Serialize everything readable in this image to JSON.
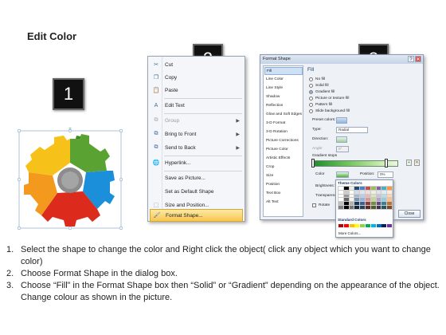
{
  "slide": {
    "title": "Edit Color"
  },
  "steps": {
    "one": "1",
    "two": "2",
    "three": "3"
  },
  "context_menu": {
    "items": [
      {
        "label": "Cut",
        "icon": "scissors-icon",
        "disabled": false,
        "submenu": false
      },
      {
        "label": "Copy",
        "icon": "copy-icon",
        "disabled": false,
        "submenu": false
      },
      {
        "label": "Paste",
        "icon": "paste-icon",
        "disabled": false,
        "submenu": false
      },
      {
        "label": "Edit Text",
        "icon": "edit-text-icon",
        "disabled": false,
        "submenu": false
      },
      {
        "label": "Group",
        "icon": "group-icon",
        "disabled": true,
        "submenu": true
      },
      {
        "label": "Bring to Front",
        "icon": "bring-front-icon",
        "disabled": false,
        "submenu": true
      },
      {
        "label": "Send to Back",
        "icon": "send-back-icon",
        "disabled": false,
        "submenu": true
      },
      {
        "label": "Hyperlink...",
        "icon": "hyperlink-icon",
        "disabled": false,
        "submenu": false
      },
      {
        "label": "Save as Picture...",
        "icon": "",
        "disabled": false,
        "submenu": false
      },
      {
        "label": "Set as Default Shape",
        "icon": "",
        "disabled": false,
        "submenu": false
      },
      {
        "label": "Size and Position...",
        "icon": "size-icon",
        "disabled": false,
        "submenu": false
      },
      {
        "label": "Format Shape...",
        "icon": "format-shape-icon",
        "disabled": false,
        "submenu": false
      }
    ]
  },
  "dialog": {
    "title": "Format Shape",
    "nav": [
      "Fill",
      "Line Color",
      "Line Style",
      "Shadow",
      "Reflection",
      "Glow and Soft Edges",
      "3-D Format",
      "3-D Rotation",
      "Picture Corrections",
      "Picture Color",
      "Artistic Effects",
      "Crop",
      "Size",
      "Position",
      "Text Box",
      "Alt Text"
    ],
    "pane_heading": "Fill",
    "fill_options": [
      "No fill",
      "Solid fill",
      "Gradient fill",
      "Picture or texture fill",
      "Pattern fill",
      "Slide background fill"
    ],
    "preset_colors_label": "Preset colors:",
    "type_label": "Type:",
    "type_value": "Radial",
    "direction_label": "Direction:",
    "angle_label": "Angle:",
    "angle_value": "0°",
    "gradient_stops_label": "Gradient stops",
    "color_label": "Color",
    "position_label": "Position:",
    "position_value": "0%",
    "brightness_label": "Brightness:",
    "transparency_label": "Transparency:",
    "rotate_label": "Rotate",
    "close_label": "Close"
  },
  "palette": {
    "theme_heading": "Theme Colors",
    "standard_heading": "Standard Colors",
    "more_label": "More Colors...",
    "theme_top": [
      "#ffffff",
      "#000000",
      "#eeece1",
      "#1f497d",
      "#4f81bd",
      "#c0504d",
      "#9bbb59",
      "#8064a2",
      "#4bacc6",
      "#f79646"
    ],
    "standard": [
      "#c00000",
      "#ff0000",
      "#ffc000",
      "#ffff00",
      "#92d050",
      "#00b050",
      "#00b0f0",
      "#0070c0",
      "#002060",
      "#7030a0"
    ]
  },
  "instructions": [
    {
      "num": "1.",
      "text": "Select the shape to change the color and Right click the object( click any object which you want to change color)"
    },
    {
      "num": "2.",
      "text": "Choose Format Shape in the dialog box."
    },
    {
      "num": "3.",
      "text": "Choose “Fill” in the Format Shape box then “Solid” or “Gradient” depending on the appearance of the object. Change colour as shown in the picture."
    }
  ],
  "colors": {
    "gear_orange": "#f39a1e",
    "gear_green": "#5aa232",
    "gear_blue": "#1c8fdb",
    "gear_red": "#dc2a1c",
    "gear_yellow": "#f6c21a",
    "gear_center": "#8c8c8c"
  }
}
